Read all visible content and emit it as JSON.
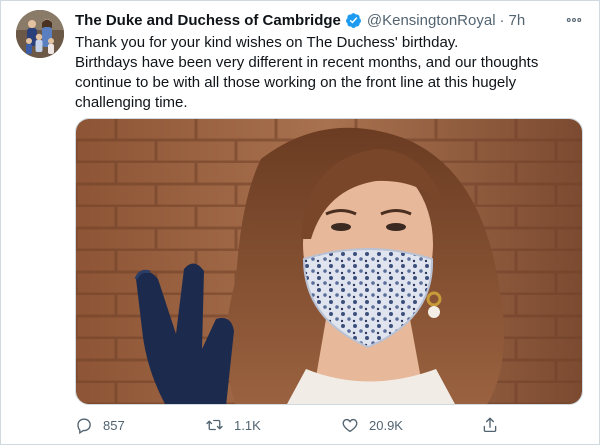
{
  "tweet": {
    "author": {
      "display_name": "The Duke and Duchess of Cambridge",
      "handle": "@KensingtonRoyal",
      "verified": true,
      "avatar_icon": "family-portrait-avatar"
    },
    "separator": "·",
    "time": "7h",
    "lines": [
      "Thank you for your kind wishes on The Duchess' birthday.",
      "Birthdays have been very different in recent months, and our thoughts continue to be with all those working on the front line at this hugely challenging time."
    ],
    "media": {
      "description_icon": "photo-woman-in-mask-waving",
      "accent": "#a8603f"
    },
    "actions": {
      "reply": {
        "icon": "reply-icon",
        "count": "857"
      },
      "retweet": {
        "icon": "retweet-icon",
        "count": "1.1K"
      },
      "like": {
        "icon": "like-icon",
        "count": "20.9K"
      },
      "share": {
        "icon": "share-icon"
      }
    }
  },
  "colors": {
    "text_primary": "#0f1419",
    "text_secondary": "#536471",
    "verified_blue": "#1d9bf0",
    "border": "#cfd9de"
  }
}
